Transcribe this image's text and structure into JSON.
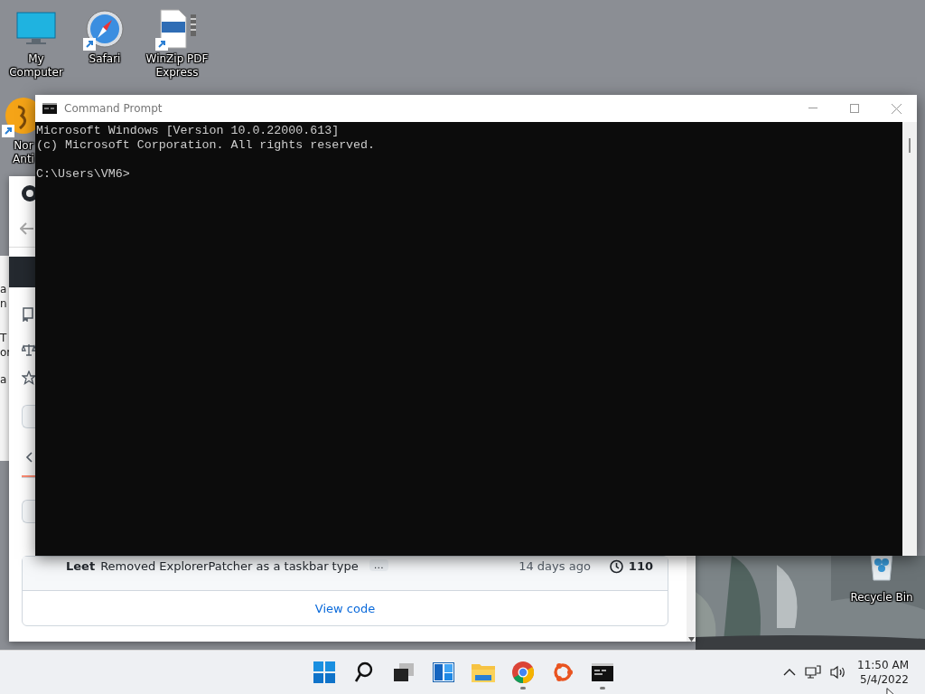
{
  "desktop_icons": [
    {
      "kind": "computer",
      "label": "My Computer",
      "shortcut": false
    },
    {
      "kind": "compass",
      "label": "Safari",
      "shortcut": true
    },
    {
      "kind": "pdf",
      "label": "WinZip PDF Express",
      "shortcut": true
    }
  ],
  "partial_icon": {
    "kind": "antivirus",
    "label": "Nor Anti",
    "shortcut": true
  },
  "recycle_bin": {
    "kind": "recycle",
    "label": "Recycle Bin",
    "shortcut": false
  },
  "side_window": {
    "lines": [
      "a",
      "n",
      "T",
      "or",
      "a"
    ]
  },
  "browser": {
    "commit": {
      "author": "Leet",
      "message": "Removed ExplorerPatcher as a taskbar type",
      "more": "…",
      "age": "14 days ago",
      "count": "110"
    },
    "view_code": "View code"
  },
  "console": {
    "title": "Command Prompt",
    "output": [
      "Microsoft Windows [Version 10.0.22000.613]",
      "(c) Microsoft Corporation. All rights reserved."
    ],
    "prompt": "C:\\Users\\VM6>"
  },
  "taskbar": {
    "apps": [
      {
        "kind": "start",
        "running": false
      },
      {
        "kind": "search",
        "running": false
      },
      {
        "kind": "taskview",
        "running": false
      },
      {
        "kind": "widgets",
        "running": false
      },
      {
        "kind": "explorer",
        "running": false
      },
      {
        "kind": "chrome",
        "running": true
      },
      {
        "kind": "ubuntu",
        "running": false
      },
      {
        "kind": "terminal",
        "running": true
      }
    ],
    "time": "11:50 AM",
    "date": "5/4/2022"
  }
}
